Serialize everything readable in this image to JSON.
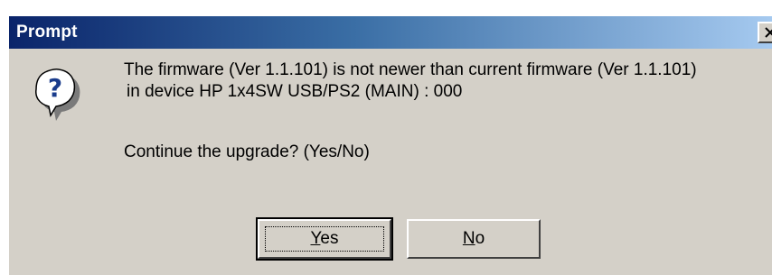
{
  "window": {
    "title": "Prompt"
  },
  "icons": {
    "question": "question-icon",
    "close": "close-icon"
  },
  "message": {
    "line1": "The firmware (Ver 1.1.101) is not newer than current firmware (Ver 1.1.101)",
    "line2": "in device HP 1x4SW USB/PS2 (MAIN) : 000",
    "question": "Continue the upgrade? (Yes/No)"
  },
  "buttons": {
    "yes_accel": "Y",
    "yes_rest": "es",
    "no_accel": "N",
    "no_rest": "o"
  },
  "colors": {
    "title_start": "#0a246a",
    "title_end": "#a6caf0",
    "face": "#d4d0c8"
  }
}
